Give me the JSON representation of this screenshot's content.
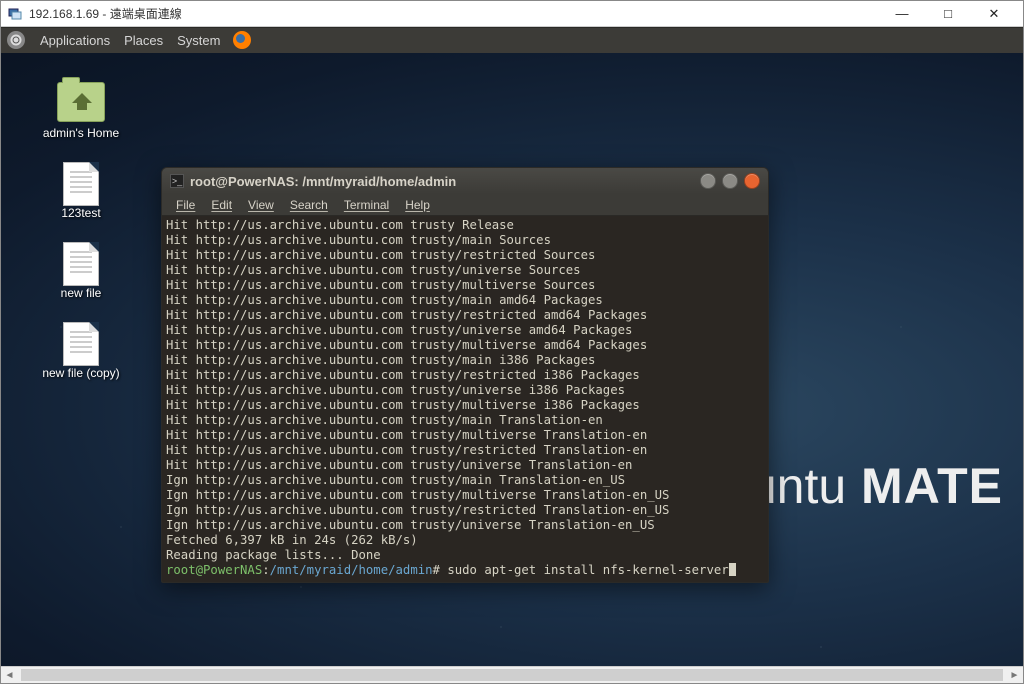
{
  "host": {
    "title": "192.168.1.69 - 遠端桌面連線",
    "min_label": "—",
    "max_label": "□",
    "close_label": "✕"
  },
  "panel": {
    "menus": [
      "Applications",
      "Places",
      "System"
    ]
  },
  "desktop": {
    "icons": [
      {
        "type": "folder",
        "label": "admin's Home"
      },
      {
        "type": "doc",
        "label": "123test"
      },
      {
        "type": "doc",
        "label": "new file"
      },
      {
        "type": "doc",
        "label": "new file (copy)"
      }
    ]
  },
  "brand": {
    "word1": "ubuntu",
    "word2": " MATE"
  },
  "terminal": {
    "title": "root@PowerNAS: /mnt/myraid/home/admin",
    "menus": [
      "File",
      "Edit",
      "View",
      "Search",
      "Terminal",
      "Help"
    ],
    "lines": [
      "Hit http://us.archive.ubuntu.com trusty Release",
      "Hit http://us.archive.ubuntu.com trusty/main Sources",
      "Hit http://us.archive.ubuntu.com trusty/restricted Sources",
      "Hit http://us.archive.ubuntu.com trusty/universe Sources",
      "Hit http://us.archive.ubuntu.com trusty/multiverse Sources",
      "Hit http://us.archive.ubuntu.com trusty/main amd64 Packages",
      "Hit http://us.archive.ubuntu.com trusty/restricted amd64 Packages",
      "Hit http://us.archive.ubuntu.com trusty/universe amd64 Packages",
      "Hit http://us.archive.ubuntu.com trusty/multiverse amd64 Packages",
      "Hit http://us.archive.ubuntu.com trusty/main i386 Packages",
      "Hit http://us.archive.ubuntu.com trusty/restricted i386 Packages",
      "Hit http://us.archive.ubuntu.com trusty/universe i386 Packages",
      "Hit http://us.archive.ubuntu.com trusty/multiverse i386 Packages",
      "Hit http://us.archive.ubuntu.com trusty/main Translation-en",
      "Hit http://us.archive.ubuntu.com trusty/multiverse Translation-en",
      "Hit http://us.archive.ubuntu.com trusty/restricted Translation-en",
      "Hit http://us.archive.ubuntu.com trusty/universe Translation-en",
      "Ign http://us.archive.ubuntu.com trusty/main Translation-en_US",
      "Ign http://us.archive.ubuntu.com trusty/multiverse Translation-en_US",
      "Ign http://us.archive.ubuntu.com trusty/restricted Translation-en_US",
      "Ign http://us.archive.ubuntu.com trusty/universe Translation-en_US",
      "Fetched 6,397 kB in 24s (262 kB/s)",
      "Reading package lists... Done"
    ],
    "prompt_user": "root@PowerNAS",
    "prompt_path": "/mnt/myraid/home/admin",
    "prompt_mark": "#",
    "command": " sudo apt-get install nfs-kernel-server"
  }
}
